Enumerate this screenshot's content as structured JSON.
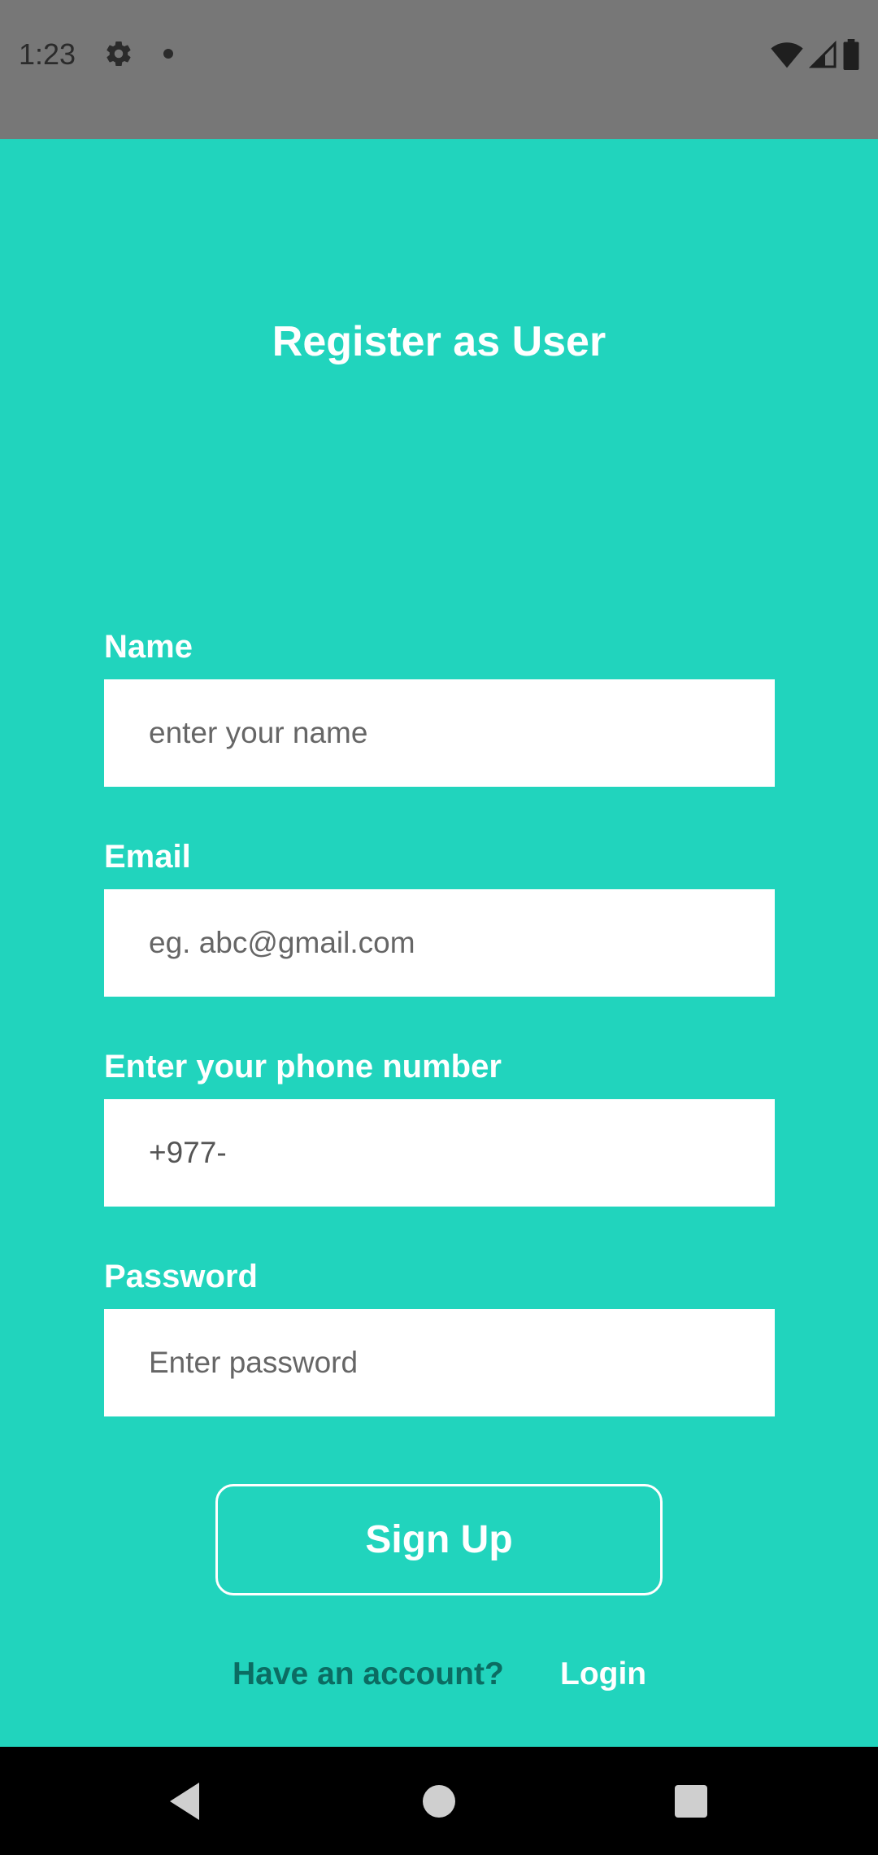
{
  "status_bar": {
    "time": "1:23",
    "icons": [
      "gear-icon",
      "notification-dot-icon",
      "wifi-icon",
      "cell-signal-icon",
      "battery-icon"
    ]
  },
  "title": "Register as User",
  "form": {
    "name": {
      "label": "Name",
      "placeholder": "enter your name"
    },
    "email": {
      "label": "Email",
      "placeholder": "eg. abc@gmail.com"
    },
    "phone": {
      "label": "Enter your phone number",
      "value": "+977-"
    },
    "password": {
      "label": "Password",
      "placeholder": "Enter password"
    }
  },
  "signup_label": "Sign Up",
  "footer": {
    "prompt": "Have an account?",
    "login_label": "Login"
  },
  "nav_bar": {
    "icons": [
      "back-icon",
      "home-icon",
      "recents-icon"
    ]
  },
  "colors": {
    "background": "#21D4BD",
    "status_bar": "#777777",
    "prompt_text": "#0B6C62"
  }
}
